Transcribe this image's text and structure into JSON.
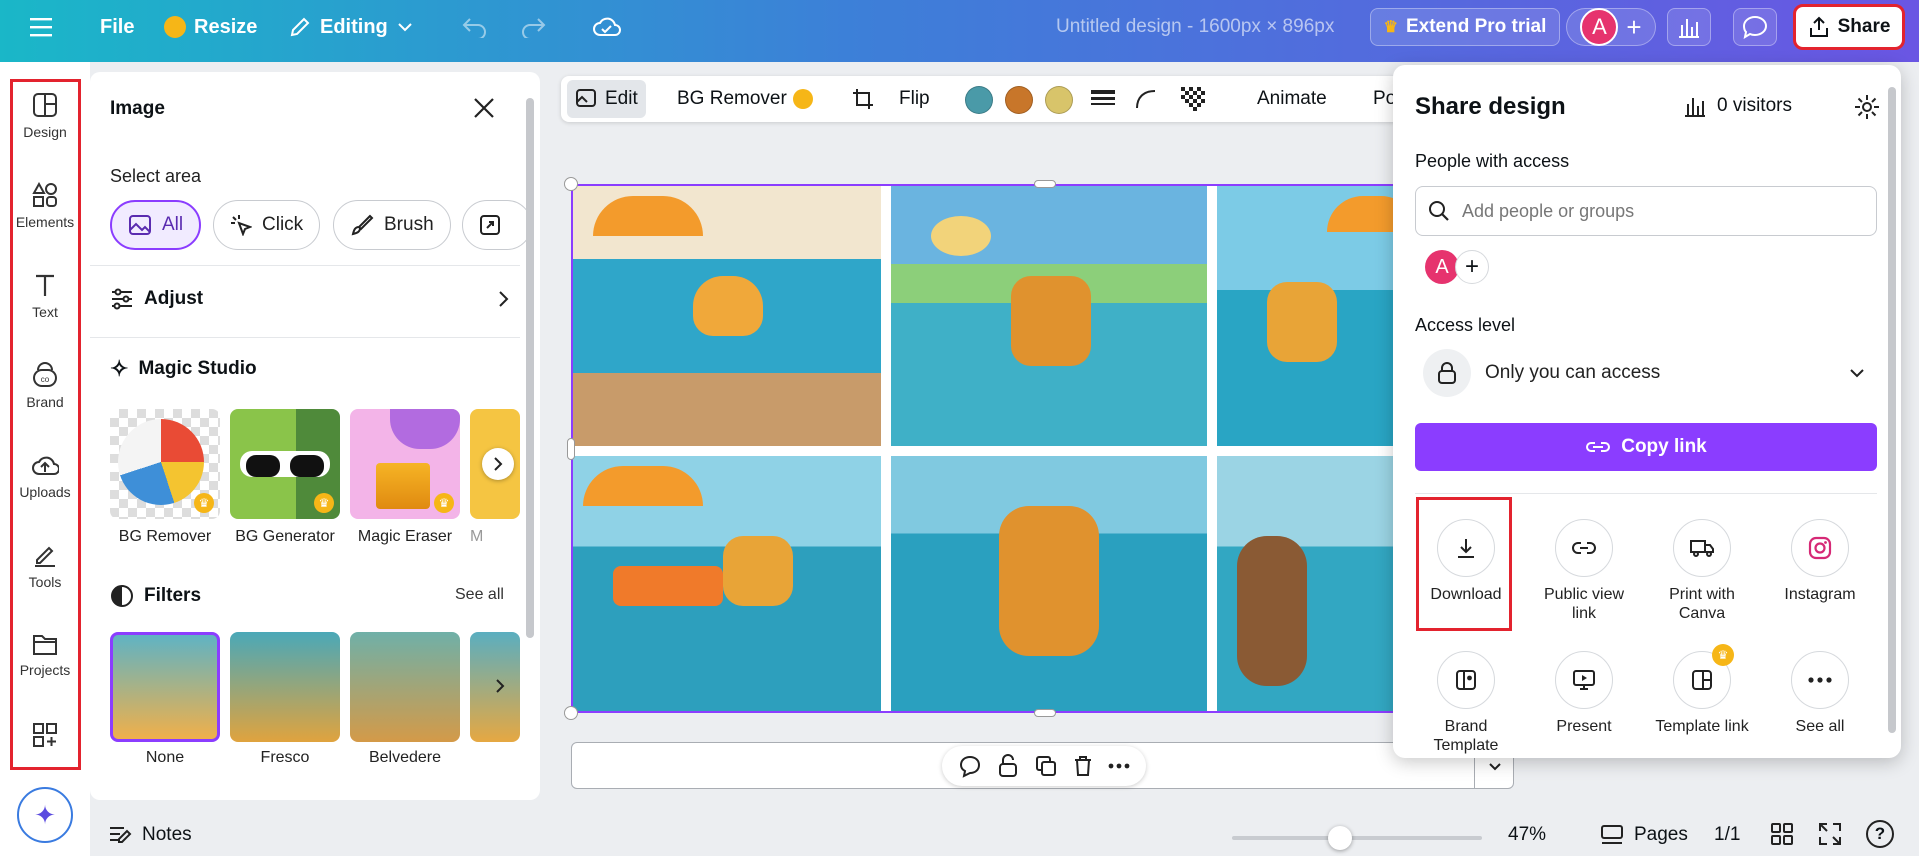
{
  "topbar": {
    "file": "File",
    "resize": "Resize",
    "editing": "Editing",
    "title": "Untitled design - 1600px × 896px",
    "extend_pro": "Extend Pro trial",
    "avatar_initial": "A",
    "share": "Share"
  },
  "sidebar": {
    "items": [
      {
        "label": "Design",
        "icon": "design-icon"
      },
      {
        "label": "Elements",
        "icon": "elements-icon"
      },
      {
        "label": "Text",
        "icon": "text-icon"
      },
      {
        "label": "Brand",
        "icon": "brand-icon"
      },
      {
        "label": "Uploads",
        "icon": "uploads-icon"
      },
      {
        "label": "Tools",
        "icon": "tools-icon"
      },
      {
        "label": "Projects",
        "icon": "projects-icon"
      },
      {
        "label": "",
        "icon": "apps-icon"
      }
    ]
  },
  "panel": {
    "title": "Image",
    "select_area": "Select area",
    "chips": [
      "All",
      "Click",
      "Brush"
    ],
    "adjust": "Adjust",
    "magic_studio": "Magic Studio",
    "magic_items": [
      "BG Remover",
      "BG Generator",
      "Magic Eraser",
      "M"
    ],
    "filters": "Filters",
    "see_all": "See all",
    "filter_items": [
      "None",
      "Fresco",
      "Belvedere"
    ]
  },
  "toolbar": {
    "edit": "Edit",
    "bg_remover": "BG Remover",
    "flip": "Flip",
    "animate": "Animate",
    "position": "Po",
    "swatches": [
      "#4a9aa8",
      "#c8762a",
      "#d8c46a"
    ]
  },
  "share": {
    "title": "Share design",
    "visitors": "0 visitors",
    "people_with_access": "People with access",
    "add_placeholder": "Add people or groups",
    "avatar_initial": "A",
    "access_level": "Access level",
    "access_value": "Only you can access",
    "copy_link": "Copy link",
    "options": [
      {
        "label": "Download",
        "icon": "download-icon"
      },
      {
        "label": "Public view link",
        "icon": "link-icon"
      },
      {
        "label": "Print with Canva",
        "icon": "truck-icon"
      },
      {
        "label": "Instagram",
        "icon": "instagram-icon"
      },
      {
        "label": "Brand Template",
        "icon": "brand-template-icon"
      },
      {
        "label": "Present",
        "icon": "present-icon"
      },
      {
        "label": "Template link",
        "icon": "template-link-icon"
      },
      {
        "label": "See all",
        "icon": "more-icon"
      }
    ]
  },
  "bottom": {
    "notes": "Notes",
    "zoom": "47%",
    "pages": "Pages",
    "page_count": "1/1"
  },
  "colors": {
    "accent": "#8b3dff",
    "highlight": "#e3232e",
    "avatar": "#e6336e"
  }
}
